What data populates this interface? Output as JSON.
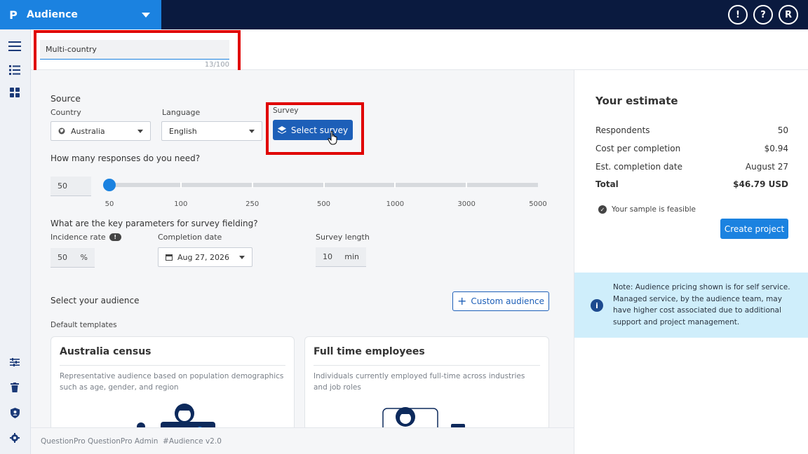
{
  "app": {
    "logo": "P",
    "title": "Audience",
    "top_icons": [
      {
        "name": "feedback-icon",
        "glyph": "!"
      },
      {
        "name": "help-icon",
        "glyph": "?"
      },
      {
        "name": "user-avatar",
        "glyph": "R"
      }
    ]
  },
  "project_name": {
    "value": "Multi-country",
    "counter": "13/100"
  },
  "source": {
    "heading": "Source",
    "country_label": "Country",
    "country_value": "Australia",
    "language_label": "Language",
    "language_value": "English",
    "survey_label": "Survey",
    "select_survey_label": "Select survey"
  },
  "responses": {
    "question": "How many responses do you need?",
    "value": "50",
    "ticks": [
      "50",
      "100",
      "250",
      "500",
      "1000",
      "3000",
      "5000"
    ],
    "selected_index": 0
  },
  "parameters": {
    "question": "What are the key parameters for survey fielding?",
    "incidence_label": "Incidence rate",
    "incidence_value": "50",
    "incidence_unit": "%",
    "completion_label": "Completion date",
    "completion_value": "Aug 27, 2026",
    "length_label": "Survey length",
    "length_value": "10",
    "length_unit": "min"
  },
  "audience": {
    "heading": "Select your audience",
    "custom_button": "Custom audience",
    "templates_label": "Default templates",
    "cards": [
      {
        "title": "Australia census",
        "description": "Representative audience based on population demographics such as age, gender, and region"
      },
      {
        "title": "Full time employees",
        "description": "Individuals currently employed full-time across industries and job roles"
      }
    ]
  },
  "estimate": {
    "title": "Your estimate",
    "rows": [
      {
        "label": "Respondents",
        "value": "50"
      },
      {
        "label": "Cost per completion",
        "value": "$0.94"
      },
      {
        "label": "Est. completion date",
        "value": "August 27"
      }
    ],
    "total_label": "Total",
    "total_value": "$46.79 USD",
    "feasible_text": "Your sample is feasible",
    "create_button": "Create project"
  },
  "note": {
    "text": "Note: Audience pricing shown is for self service. Managed service, by the audience team, may have higher cost associated due to additional support and project management."
  },
  "footer": {
    "text": "QuestionPro QuestionPro Admin  #Audience v2.0"
  },
  "colors": {
    "brand_blue": "#1b82e0",
    "topbar_navy": "#0a1a3f",
    "primary_button": "#1d5fb8",
    "highlight_red": "#e00000",
    "note_bg": "#cfeefb"
  }
}
